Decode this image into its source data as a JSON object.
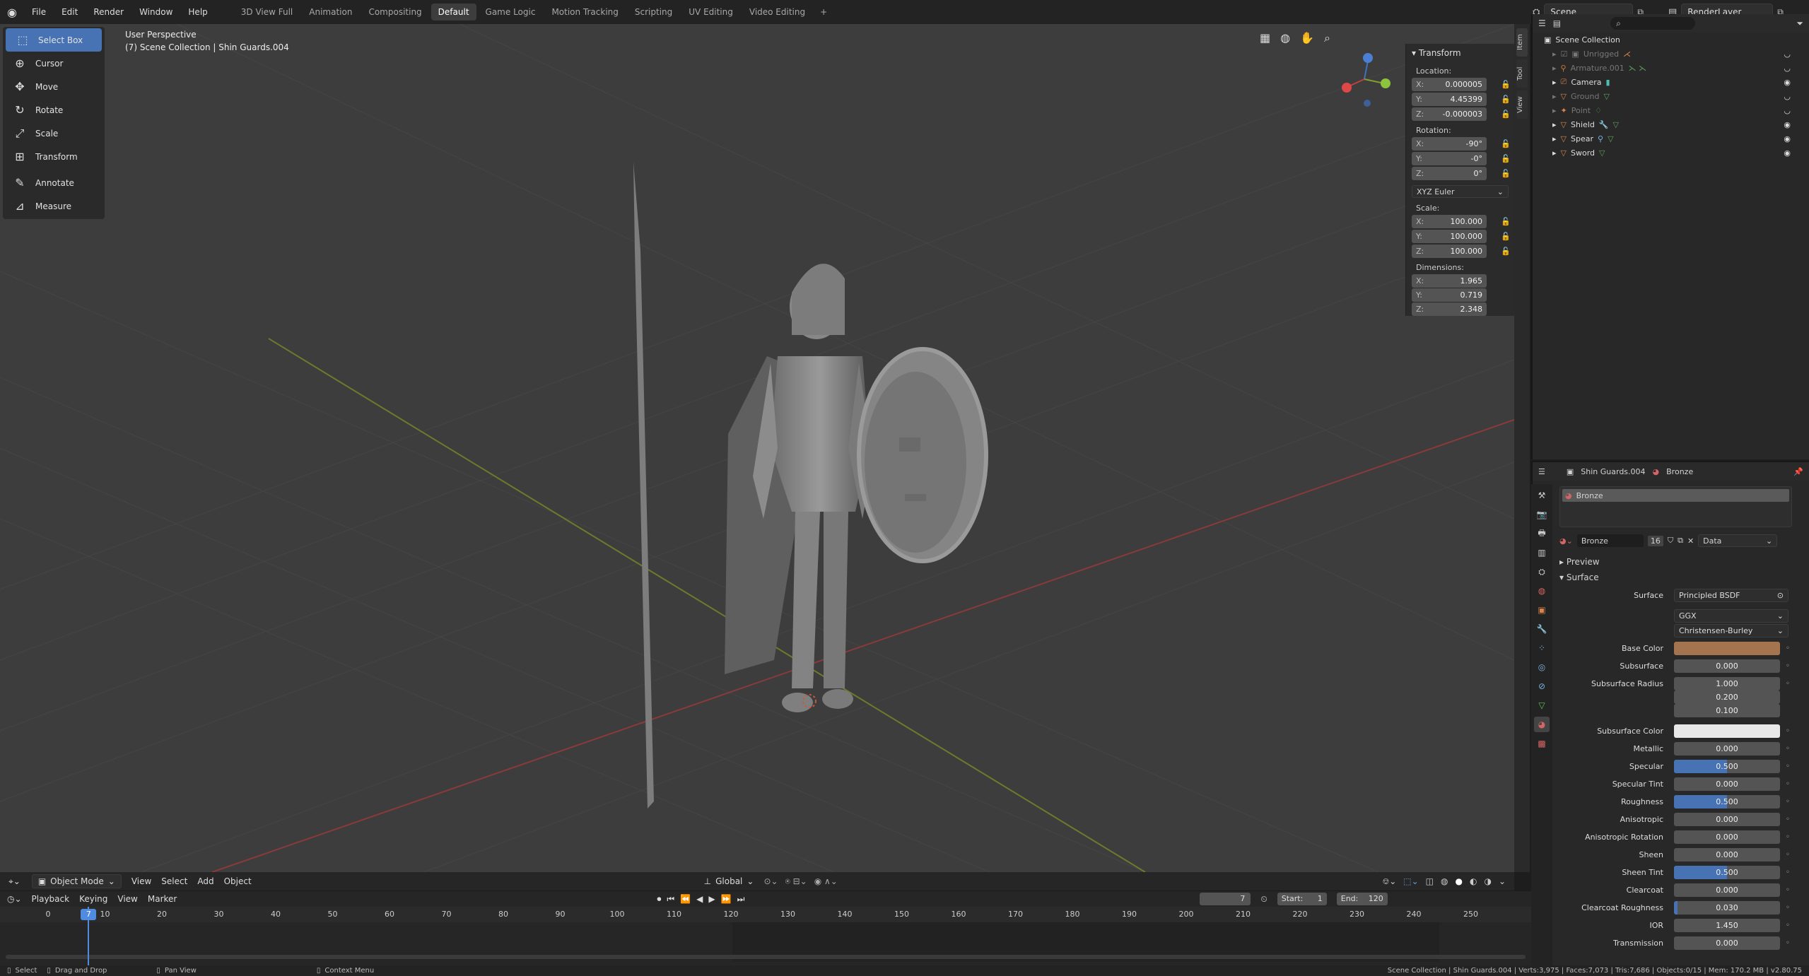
{
  "topbar": {
    "menus": [
      "File",
      "Edit",
      "Render",
      "Window",
      "Help"
    ],
    "workspaces": [
      "3D View Full",
      "Animation",
      "Compositing",
      "Default",
      "Game Logic",
      "Motion Tracking",
      "Scripting",
      "UV Editing",
      "Video Editing"
    ],
    "active_workspace": "Default",
    "add_tab": "+",
    "scene": "Scene",
    "render_layer": "RenderLayer"
  },
  "viewport": {
    "view_name": "User Perspective",
    "collection_info": "(7) Scene Collection | Shin Guards.004",
    "tools": [
      {
        "label": "Select Box",
        "icon": "select-box-icon",
        "glyph": "⬚"
      },
      {
        "label": "Cursor",
        "icon": "cursor-icon",
        "glyph": "⊕"
      },
      {
        "label": "Move",
        "icon": "move-icon",
        "glyph": "✥"
      },
      {
        "label": "Rotate",
        "icon": "rotate-icon",
        "glyph": "↻"
      },
      {
        "label": "Scale",
        "icon": "scale-icon",
        "glyph": "⤢"
      },
      {
        "label": "Transform",
        "icon": "transform-icon",
        "glyph": "⊞"
      },
      {
        "label": "Annotate",
        "icon": "annotate-icon",
        "glyph": "✎"
      },
      {
        "label": "Measure",
        "icon": "measure-icon",
        "glyph": "📐"
      }
    ],
    "header": {
      "mode": "Object Mode",
      "menus": [
        "View",
        "Select",
        "Add",
        "Object"
      ],
      "orientation": "Global"
    }
  },
  "transform_panel": {
    "title": "Transform",
    "location_label": "Location:",
    "location": [
      {
        "axis": "X:",
        "value": "0.000005"
      },
      {
        "axis": "Y:",
        "value": "4.45399"
      },
      {
        "axis": "Z:",
        "value": "-0.000003"
      }
    ],
    "rotation_label": "Rotation:",
    "rotation": [
      {
        "axis": "X:",
        "value": "-90°"
      },
      {
        "axis": "Y:",
        "value": "-0°"
      },
      {
        "axis": "Z:",
        "value": "0°"
      }
    ],
    "rotation_mode": "XYZ Euler",
    "scale_label": "Scale:",
    "scale": [
      {
        "axis": "X:",
        "value": "100.000"
      },
      {
        "axis": "Y:",
        "value": "100.000"
      },
      {
        "axis": "Z:",
        "value": "100.000"
      }
    ],
    "dimensions_label": "Dimensions:",
    "dimensions": [
      {
        "axis": "X:",
        "value": "1.965"
      },
      {
        "axis": "Y:",
        "value": "0.719"
      },
      {
        "axis": "Z:",
        "value": "2.348"
      }
    ],
    "side_tabs": [
      "Item",
      "Tool",
      "View"
    ]
  },
  "outliner": {
    "root": "Scene Collection",
    "items": [
      {
        "name": "Unrigged",
        "dim": true,
        "visible": false
      },
      {
        "name": "Armature.001",
        "dim": true,
        "visible": false
      },
      {
        "name": "Camera",
        "dim": false,
        "visible": true
      },
      {
        "name": "Ground",
        "dim": true,
        "visible": false
      },
      {
        "name": "Point",
        "dim": true,
        "visible": false
      },
      {
        "name": "Shield",
        "dim": false,
        "visible": true
      },
      {
        "name": "Spear",
        "dim": false,
        "visible": true
      },
      {
        "name": "Sword",
        "dim": false,
        "visible": true
      }
    ]
  },
  "properties": {
    "object_name": "Shin Guards.004",
    "material_name": "Bronze",
    "slot_name": "Bronze",
    "user_count": "16",
    "link_mode": "Data",
    "preview_label": "Preview",
    "surface_section": "Surface",
    "surface_label": "Surface",
    "surface_shader": "Principled BSDF",
    "distribution": "GGX",
    "subsurface_method": "Christensen-Burley",
    "base_color_label": "Base Color",
    "base_color": "#a4744e",
    "subsurface_color_label": "Subsurface Color",
    "subsurface_color": "#e8e8e8",
    "fields": [
      {
        "label": "Subsurface",
        "value": "0.000",
        "fill": 0
      },
      {
        "label": "Metallic",
        "value": "0.000",
        "fill": 0
      },
      {
        "label": "Specular",
        "value": "0.500",
        "fill": 0.5
      },
      {
        "label": "Specular Tint",
        "value": "0.000",
        "fill": 0
      },
      {
        "label": "Roughness",
        "value": "0.500",
        "fill": 0.5
      },
      {
        "label": "Anisotropic",
        "value": "0.000",
        "fill": 0
      },
      {
        "label": "Anisotropic Rotation",
        "value": "0.000",
        "fill": 0
      },
      {
        "label": "Sheen",
        "value": "0.000",
        "fill": 0
      },
      {
        "label": "Sheen Tint",
        "value": "0.500",
        "fill": 0.5
      },
      {
        "label": "Clearcoat",
        "value": "0.000",
        "fill": 0
      },
      {
        "label": "Clearcoat Roughness",
        "value": "0.030",
        "fill": 0.03
      },
      {
        "label": "IOR",
        "value": "1.450",
        "fill": 0
      },
      {
        "label": "Transmission",
        "value": "0.000",
        "fill": 0
      }
    ],
    "subsurface_radius_label": "Subsurface Radius",
    "subsurface_radius": [
      "1.000",
      "0.200",
      "0.100"
    ]
  },
  "timeline": {
    "menus": [
      "Playback",
      "Keying",
      "View",
      "Marker"
    ],
    "current_frame": "7",
    "start_label": "Start:",
    "start": "1",
    "end_label": "End:",
    "end": "120",
    "ticks": [
      "0",
      "10",
      "20",
      "30",
      "40",
      "50",
      "60",
      "70",
      "80",
      "90",
      "100",
      "110",
      "120",
      "130",
      "140",
      "150",
      "160",
      "170",
      "180",
      "190",
      "200",
      "210",
      "220",
      "230",
      "240",
      "250"
    ]
  },
  "statusbar": {
    "select": "Select",
    "drag": "Drag and Drop",
    "pan": "Pan View",
    "context": "Context Menu",
    "stats": "Scene Collection | Shin Guards.004 | Verts:3,975 | Faces:7,073 | Tris:7,686 | Objects:0/15 | Mem: 170.2 MB | v2.80.75"
  }
}
